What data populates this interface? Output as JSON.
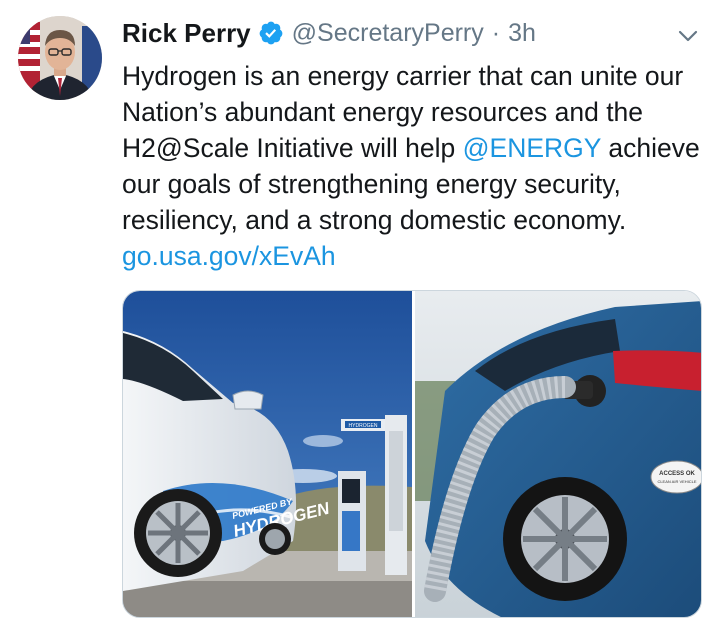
{
  "tweet": {
    "author_name": "Rick Perry",
    "handle": "@SecretaryPerry",
    "separator": "·",
    "time": "3h",
    "text_part1": "Hydrogen is an energy carrier that can unite our Nation’s abundant energy resources and the H2@Scale Initiative will help ",
    "mention": "@ENERGY",
    "text_part2": " achieve our goals of strengthening energy security, resiliency, and a strong domestic economy. ",
    "link": "go.usa.gov/xEvAh"
  },
  "media": {
    "left_image": {
      "car_branding": "HYDROGEN",
      "car_branding_small": "POWERED BY",
      "station_sign": "HYDROGEN"
    },
    "right_image": {
      "car_decal": "ACCESS OK",
      "car_decal_small": "CLEAN AIR VEHICLE"
    }
  },
  "icons": [
    "avatar",
    "verified-badge-icon",
    "chevron-down-icon"
  ],
  "colors": {
    "link": "#1b95e0",
    "verified": "#1da1f2",
    "secondary_text": "#657786",
    "primary_text": "#14171a"
  }
}
